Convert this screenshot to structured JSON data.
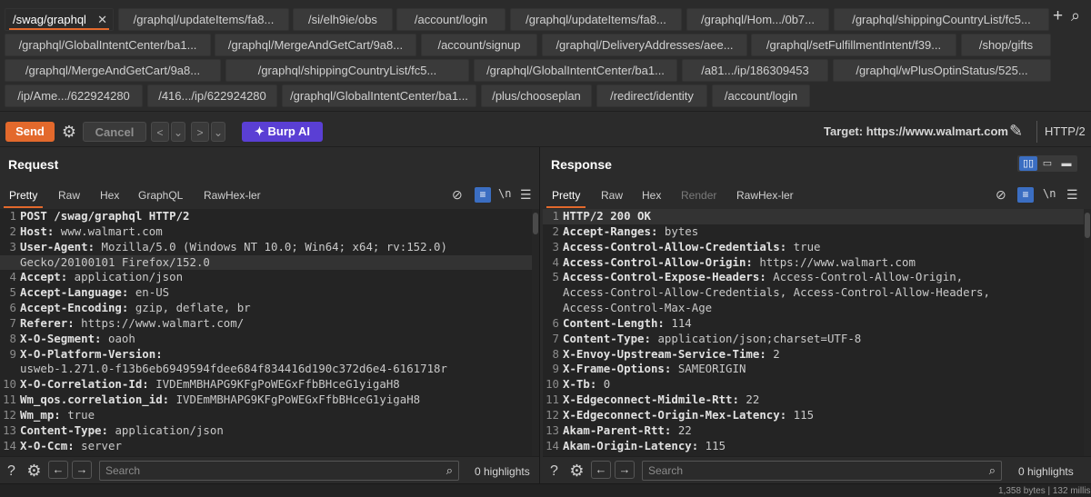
{
  "tabs": {
    "rows": [
      [
        {
          "label": "/swag/graphql",
          "active": true
        },
        {
          "label": "/graphql/updateItems/fa8..."
        },
        {
          "label": "/si/elh9ie/obs"
        },
        {
          "label": "/account/login"
        },
        {
          "label": "/graphql/updateItems/fa8..."
        },
        {
          "label": "/graphql/Hom.../0b7..."
        },
        {
          "label": "/graphql/shippingCountryList/fc5..."
        }
      ],
      [
        {
          "label": "/graphql/GlobalIntentCenter/ba1..."
        },
        {
          "label": "/graphql/MergeAndGetCart/9a8..."
        },
        {
          "label": "/account/signup"
        },
        {
          "label": "/graphql/DeliveryAddresses/aee..."
        },
        {
          "label": "/graphql/setFulfillmentIntent/f39..."
        },
        {
          "label": "/shop/gifts"
        }
      ],
      [
        {
          "label": "/graphql/MergeAndGetCart/9a8..."
        },
        {
          "label": "/graphql/shippingCountryList/fc5..."
        },
        {
          "label": "/graphql/GlobalIntentCenter/ba1..."
        },
        {
          "label": "/a81.../ip/186309453"
        },
        {
          "label": "/graphql/wPlusOptinStatus/525..."
        }
      ],
      [
        {
          "label": "/ip/Ame.../622924280"
        },
        {
          "label": "/416.../ip/622924280"
        },
        {
          "label": "/graphql/GlobalIntentCenter/ba1..."
        },
        {
          "label": "/plus/chooseplan"
        },
        {
          "label": "/redirect/identity"
        },
        {
          "label": "/account/login"
        }
      ]
    ],
    "close_glyph": "✕",
    "add_glyph": "+",
    "search_glyph": "⌕"
  },
  "toolbar": {
    "send_label": "Send",
    "cancel_label": "Cancel",
    "back_glyph": "<",
    "forward_glyph": ">",
    "dropdown_glyph": "⌄",
    "burp_ai_label": "Burp AI",
    "target_label": "Target: https://www.walmart.com",
    "protocol_label": "HTTP/2"
  },
  "request": {
    "title": "Request",
    "tabs": [
      "Pretty",
      "Raw",
      "Hex",
      "GraphQL",
      "RawHex-ler"
    ],
    "active_tab": "Pretty",
    "search_placeholder": "Search",
    "highlights_label": "0 highlights",
    "lines": [
      {
        "n": "1",
        "key": "POST /swag/graphql HTTP/2",
        "value": ""
      },
      {
        "n": "2",
        "key": "Host:",
        "value": " www.walmart.com"
      },
      {
        "n": "3",
        "key": "User-Agent:",
        "value": " Mozilla/5.0 (Windows NT 10.0; Win64; x64; rv:152.0)"
      },
      {
        "n": "",
        "key": "",
        "value": "Gecko/20100101 Firefox/152.0",
        "highlight": true
      },
      {
        "n": "4",
        "key": "Accept:",
        "value": " application/json"
      },
      {
        "n": "5",
        "key": "Accept-Language:",
        "value": " en-US"
      },
      {
        "n": "6",
        "key": "Accept-Encoding:",
        "value": " gzip, deflate, br"
      },
      {
        "n": "7",
        "key": "Referer:",
        "value": " https://www.walmart.com/"
      },
      {
        "n": "8",
        "key": "X-O-Segment:",
        "value": " oaoh"
      },
      {
        "n": "9",
        "key": "X-O-Platform-Version:",
        "value": ""
      },
      {
        "n": "",
        "key": "",
        "value": "usweb-1.271.0-f13b6eb6949594fdee684f834416d190c372d6e4-6161718r"
      },
      {
        "n": "10",
        "key": "X-O-Correlation-Id:",
        "value": " IVDEmMBHAPG9KFgPoWEGxFfbBHceG1yigaH8"
      },
      {
        "n": "11",
        "key": "Wm_qos.correlation_id:",
        "value": " IVDEmMBHAPG9KFgPoWEGxFfbBHceG1yigaH8"
      },
      {
        "n": "12",
        "key": "Wm_mp:",
        "value": " true"
      },
      {
        "n": "13",
        "key": "Content-Type:",
        "value": " application/json"
      },
      {
        "n": "14",
        "key": "X-O-Ccm:",
        "value": " server"
      }
    ]
  },
  "response": {
    "title": "Response",
    "tabs": [
      "Pretty",
      "Raw",
      "Hex",
      "Render",
      "RawHex-ler"
    ],
    "active_tab": "Pretty",
    "disabled_tab": "Render",
    "search_placeholder": "Search",
    "highlights_label": "0 highlights",
    "lines": [
      {
        "n": "1",
        "key": "HTTP/2 200 OK",
        "value": "",
        "highlight": true
      },
      {
        "n": "2",
        "key": "Accept-Ranges:",
        "value": " bytes"
      },
      {
        "n": "3",
        "key": "Access-Control-Allow-Credentials:",
        "value": " true"
      },
      {
        "n": "4",
        "key": "Access-Control-Allow-Origin:",
        "value": " https://www.walmart.com"
      },
      {
        "n": "5",
        "key": "Access-Control-Expose-Headers:",
        "value": " Access-Control-Allow-Origin,"
      },
      {
        "n": "",
        "key": "",
        "value": "Access-Control-Allow-Credentials, Access-Control-Allow-Headers,"
      },
      {
        "n": "",
        "key": "",
        "value": "Access-Control-Max-Age"
      },
      {
        "n": "6",
        "key": "Content-Length:",
        "value": " 114"
      },
      {
        "n": "7",
        "key": "Content-Type:",
        "value": " application/json;charset=UTF-8"
      },
      {
        "n": "8",
        "key": "X-Envoy-Upstream-Service-Time:",
        "value": " 2"
      },
      {
        "n": "9",
        "key": "X-Frame-Options:",
        "value": " SAMEORIGIN"
      },
      {
        "n": "10",
        "key": "X-Tb:",
        "value": " 0"
      },
      {
        "n": "11",
        "key": "X-Edgeconnect-Midmile-Rtt:",
        "value": " 22"
      },
      {
        "n": "12",
        "key": "X-Edgeconnect-Origin-Mex-Latency:",
        "value": " 115"
      },
      {
        "n": "13",
        "key": "Akam-Parent-Rtt:",
        "value": " 22"
      },
      {
        "n": "14",
        "key": "Akam-Origin-Latency:",
        "value": " 115"
      }
    ]
  },
  "colors": {
    "accent": "#e3692c",
    "burp_ai": "#5a3fd4",
    "selected_blue": "#3b6ec2",
    "background": "#2b2b2b",
    "editor_background": "#242424"
  },
  "icons": {
    "settings": "gear-icon",
    "edit": "pencil-icon",
    "help": "help-icon",
    "ai_sparkle": "sparkle-icon",
    "hide": "eye-off-icon",
    "wrap": "wrap-icon",
    "newline": "\\n",
    "menu": "menu-icon"
  },
  "statusbar": {
    "text": "1,358 bytes | 132 millis"
  }
}
